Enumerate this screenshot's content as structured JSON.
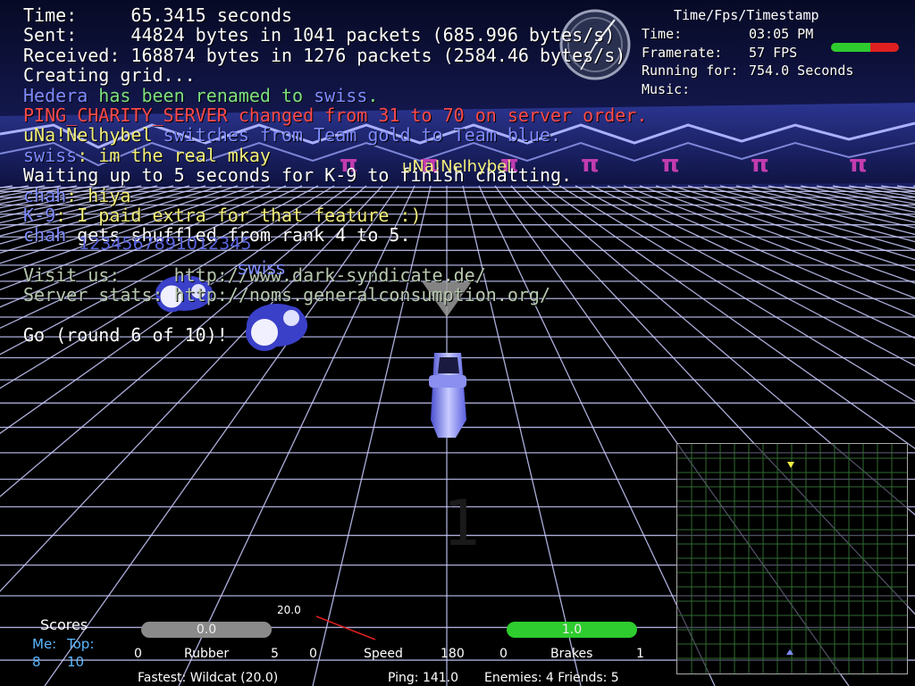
{
  "console": [
    {
      "segments": [
        {
          "t": "Time:     65.3415 seconds",
          "c": "white"
        }
      ]
    },
    {
      "segments": [
        {
          "t": "Sent:     44824 bytes in 1041 packets (685.996 bytes/s)",
          "c": "white"
        }
      ]
    },
    {
      "segments": [
        {
          "t": "Received: 168874 bytes in 1276 packets (2584.46 bytes/s)",
          "c": "white"
        }
      ]
    },
    {
      "segments": [
        {
          "t": "Creating grid...",
          "c": "white"
        }
      ]
    },
    {
      "segments": [
        {
          "t": "Hedera",
          "c": "blue"
        },
        {
          "t": " has been renamed to ",
          "c": "green"
        },
        {
          "t": "swiss",
          "c": "blue"
        },
        {
          "t": ".",
          "c": "green"
        }
      ]
    },
    {
      "segments": [
        {
          "t": "PING_CHARITY_SERVER changed from 31 to 70 on server order.",
          "c": "red"
        }
      ]
    },
    {
      "segments": [
        {
          "t": "uNa!Nelhybel",
          "c": "yellow"
        },
        {
          "t": " switches from Team gold to Team blue.",
          "c": "blue"
        }
      ]
    },
    {
      "segments": [
        {
          "t": "swiss",
          "c": "blue"
        },
        {
          "t": ": im the real mkay",
          "c": "yellow"
        }
      ]
    },
    {
      "segments": [
        {
          "t": "Waiting up to 5 seconds for K-9 to finish chatting.",
          "c": "white"
        }
      ]
    },
    {
      "segments": [
        {
          "t": "chah",
          "c": "blue"
        },
        {
          "t": ": hiya",
          "c": "yellow"
        }
      ]
    },
    {
      "segments": [
        {
          "t": "K-9",
          "c": "blue"
        },
        {
          "t": ": I paid extra for that feature :)",
          "c": "yellow"
        }
      ]
    },
    {
      "segments": [
        {
          "t": "chah",
          "c": "blue"
        },
        {
          "t": " gets shuffled from rank 4 to 5.",
          "c": "white"
        }
      ]
    },
    {
      "segments": [
        {
          "t": " ",
          "c": "white"
        }
      ]
    },
    {
      "segments": [
        {
          "t": "Visit us:     http://www.dark-syndicate.de/",
          "c": "gray"
        }
      ]
    },
    {
      "segments": [
        {
          "t": "Server stats: http://noms.generalconsumption.org/",
          "c": "gray"
        }
      ]
    },
    {
      "segments": [
        {
          "t": " ",
          "c": "white"
        }
      ]
    },
    {
      "segments": [
        {
          "t": "Go (round 6 of 10)!",
          "c": "white"
        }
      ]
    }
  ],
  "tfs": {
    "title": "Time/Fps/Timestamp",
    "rows": [
      {
        "k": "Time:",
        "v": "03:05 PM"
      },
      {
        "k": "Framerate:",
        "v": "57 FPS"
      },
      {
        "k": "Running for:",
        "v": "754.0 Seconds"
      },
      {
        "k": "Music:",
        "v": ""
      }
    ]
  },
  "nametags": {
    "swiss": "swiss",
    "top": "uNa!Nelhybel",
    "mid": "1234567891012345"
  },
  "hud": {
    "scores_title": "Scores",
    "me_label": "Me:",
    "top_label": "Top:",
    "me_value": "8",
    "top_value": "10",
    "rubber": {
      "label": "Rubber",
      "value": "0.0",
      "min": "0",
      "max": "5",
      "fraction": 0.0
    },
    "speed": {
      "label": "Speed",
      "top": "20.0",
      "min": "0",
      "max": "180"
    },
    "brakes": {
      "label": "Brakes",
      "value": "1.0",
      "min": "0",
      "max": "1",
      "fraction": 1.0
    },
    "fastest": "Fastest: Wildcat (20.0)",
    "ping": "Ping: 141.0",
    "enemies": "Enemies: 4 Friends: 5"
  },
  "colors": {
    "grid": "#c9ccff",
    "sky": "#0b1040",
    "brakes": "#2ecc2e",
    "rubber": "#9a9a9a"
  }
}
